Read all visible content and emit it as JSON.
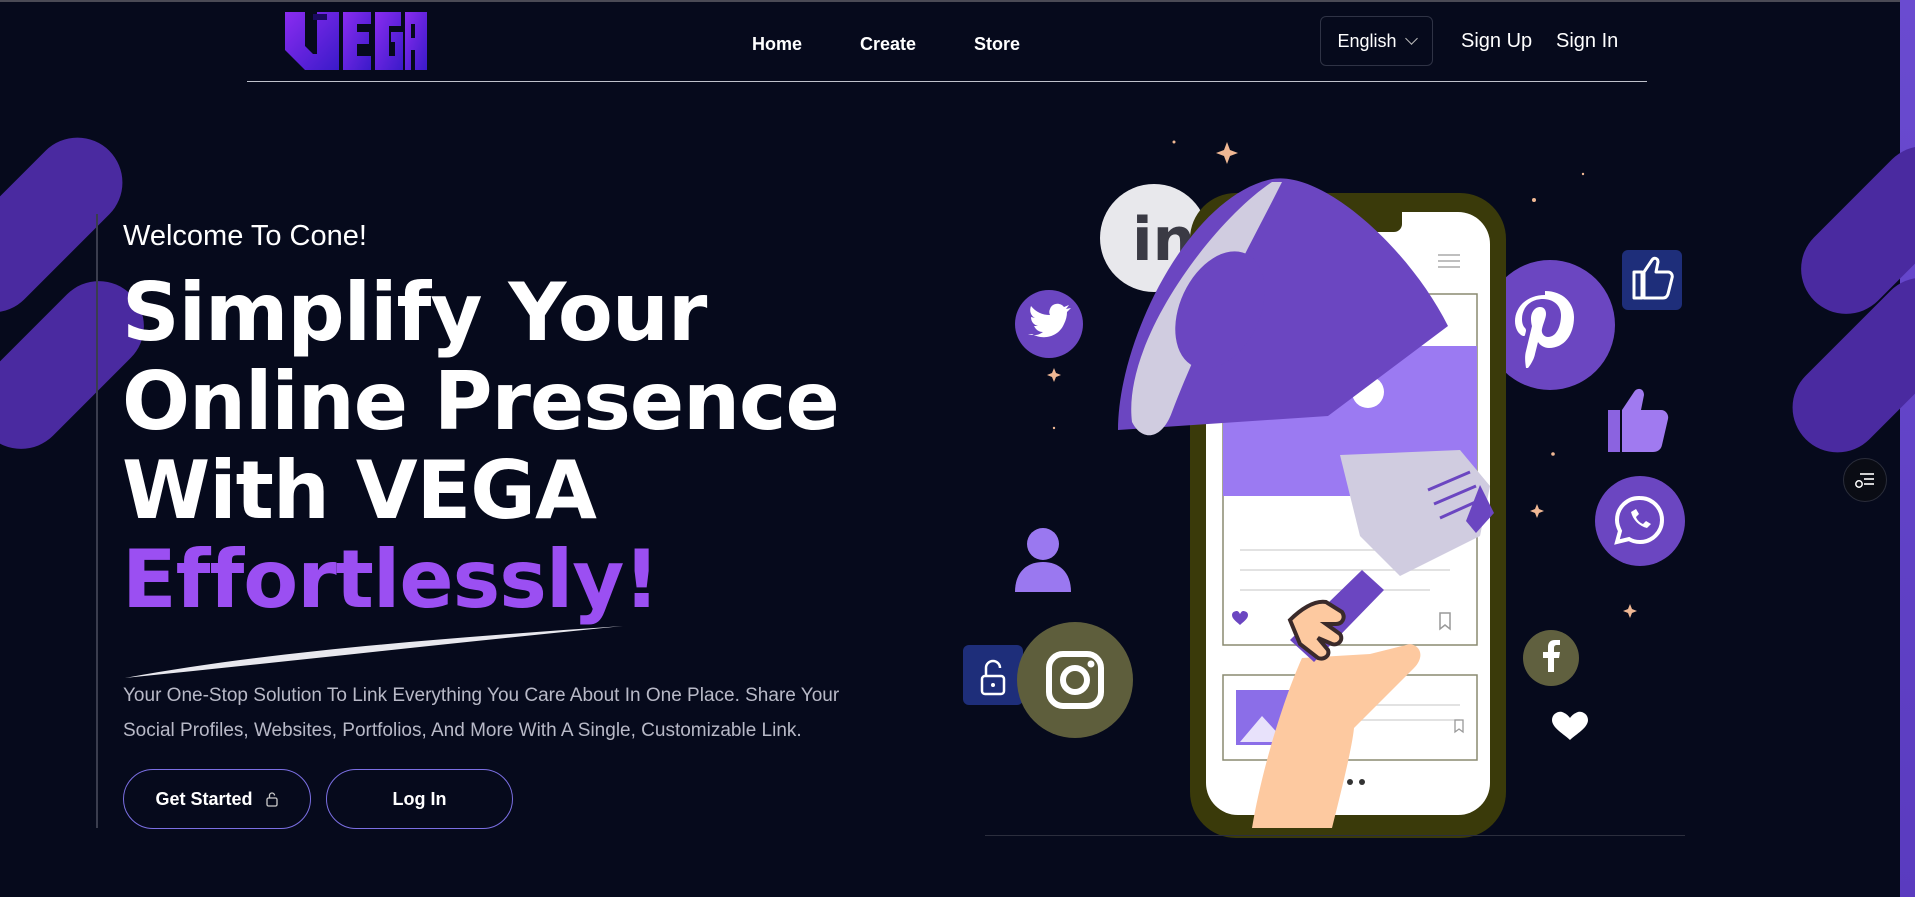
{
  "header": {
    "logo_text": "VEGA",
    "nav": [
      "Home",
      "Create",
      "Store"
    ],
    "language": "English",
    "sign_up": "Sign Up",
    "sign_in": "Sign In"
  },
  "hero": {
    "welcome": "Welcome To Cone!",
    "headline_lines": [
      "Simplify Your",
      "Online Presence",
      "With VEGA"
    ],
    "headline_accent": "Effortlessly!",
    "description": "Your One-Stop Solution To Link Everything You Care About In One Place. Share Your Social Profiles, Websites, Portfolios, And More With A Single, Customizable Link.",
    "get_started": "Get Started",
    "log_in": "Log In"
  },
  "colors": {
    "background": "#060a1c",
    "accent": "#9b4ff2",
    "bar": "#4a2aa0",
    "button_border": "#7b6fe3",
    "phone_frame": "#3a3a0a"
  },
  "icons": [
    "linkedin-icon",
    "twitter-icon",
    "pinterest-icon",
    "thumbs-up-icon",
    "whatsapp-icon",
    "user-icon",
    "lock-icon",
    "instagram-icon",
    "facebook-icon",
    "heart-icon",
    "megaphone-icon"
  ]
}
